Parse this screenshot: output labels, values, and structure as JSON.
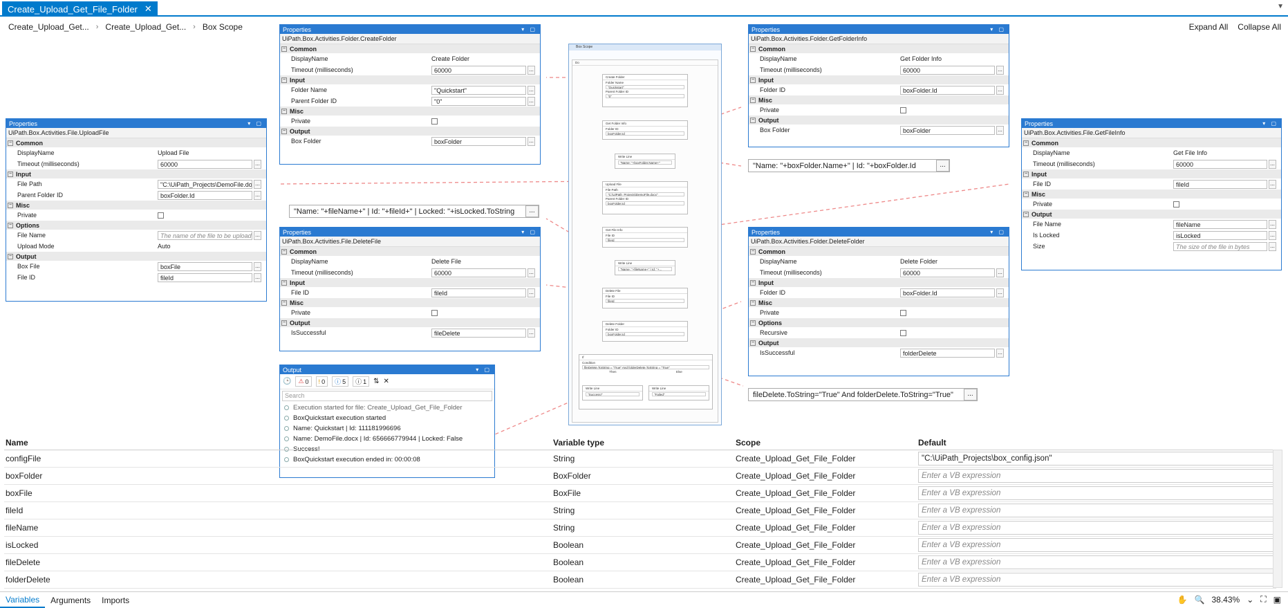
{
  "tab": {
    "title": "Create_Upload_Get_File_Folder",
    "close": "✕"
  },
  "breadcrumb": [
    "Create_Upload_Get...",
    "Create_Upload_Get...",
    "Box Scope"
  ],
  "expand_all": "Expand All",
  "collapse_all": "Collapse All",
  "panel_title": "Properties",
  "panels": {
    "create_folder": {
      "type": "UiPath.Box.Activities.Folder.CreateFolder",
      "cats": [
        [
          "Common",
          [
            [
              "DisplayName",
              "Create Folder",
              "text"
            ],
            [
              "Timeout (milliseconds)",
              "60000",
              "field"
            ]
          ]
        ],
        [
          "Input",
          [
            [
              "Folder Name",
              "\"Quickstart\"",
              "field"
            ],
            [
              "Parent Folder ID",
              "\"0\"",
              "field"
            ]
          ]
        ],
        [
          "Misc",
          [
            [
              "Private",
              "",
              "check"
            ]
          ]
        ],
        [
          "Output",
          [
            [
              "Box Folder",
              "boxFolder",
              "field"
            ]
          ]
        ]
      ]
    },
    "upload_file": {
      "type": "UiPath.Box.Activities.File.UploadFile",
      "cats": [
        [
          "Common",
          [
            [
              "DisplayName",
              "Upload File",
              "text"
            ],
            [
              "Timeout (milliseconds)",
              "60000",
              "field"
            ]
          ]
        ],
        [
          "Input",
          [
            [
              "File Path",
              "\"C:\\UiPath_Projects\\DemoFile.doc",
              "field"
            ],
            [
              "Parent Folder ID",
              "boxFolder.Id",
              "field"
            ]
          ]
        ],
        [
          "Misc",
          [
            [
              "Private",
              "",
              "check"
            ]
          ]
        ],
        [
          "Options",
          [
            [
              "File Name",
              "The name of the file to be uploade",
              "ph"
            ],
            [
              "Upload Mode",
              "Auto",
              "text"
            ]
          ]
        ],
        [
          "Output",
          [
            [
              "Box File",
              "boxFile",
              "field"
            ],
            [
              "File ID",
              "fileId",
              "field"
            ]
          ]
        ]
      ]
    },
    "delete_file": {
      "type": "UiPath.Box.Activities.File.DeleteFile",
      "cats": [
        [
          "Common",
          [
            [
              "DisplayName",
              "Delete File",
              "text"
            ],
            [
              "Timeout (milliseconds)",
              "60000",
              "field"
            ]
          ]
        ],
        [
          "Input",
          [
            [
              "File ID",
              "fileId",
              "field"
            ]
          ]
        ],
        [
          "Misc",
          [
            [
              "Private",
              "",
              "check"
            ]
          ]
        ],
        [
          "Output",
          [
            [
              "IsSuccessful",
              "fileDelete",
              "field"
            ]
          ]
        ]
      ]
    },
    "get_folder_info": {
      "type": "UiPath.Box.Activities.Folder.GetFolderInfo",
      "cats": [
        [
          "Common",
          [
            [
              "DisplayName",
              "Get Folder Info",
              "text"
            ],
            [
              "Timeout (milliseconds)",
              "60000",
              "field"
            ]
          ]
        ],
        [
          "Input",
          [
            [
              "Folder ID",
              "boxFolder.Id",
              "field"
            ]
          ]
        ],
        [
          "Misc",
          [
            [
              "Private",
              "",
              "check"
            ]
          ]
        ],
        [
          "Output",
          [
            [
              "Box Folder",
              "boxFolder",
              "field"
            ]
          ]
        ]
      ]
    },
    "get_file_info": {
      "type": "UiPath.Box.Activities.File.GetFileInfo",
      "cats": [
        [
          "Common",
          [
            [
              "DisplayName",
              "Get File Info",
              "text"
            ],
            [
              "Timeout (milliseconds)",
              "60000",
              "field"
            ]
          ]
        ],
        [
          "Input",
          [
            [
              "File ID",
              "fileId",
              "field"
            ]
          ]
        ],
        [
          "Misc",
          [
            [
              "Private",
              "",
              "check"
            ]
          ]
        ],
        [
          "Output",
          [
            [
              "File Name",
              "fileName",
              "field"
            ],
            [
              "Is Locked",
              "isLocked",
              "field"
            ],
            [
              "Size",
              "The size of the file in bytes",
              "ph"
            ]
          ]
        ]
      ]
    },
    "delete_folder": {
      "type": "UiPath.Box.Activities.Folder.DeleteFolder",
      "cats": [
        [
          "Common",
          [
            [
              "DisplayName",
              "Delete Folder",
              "text"
            ],
            [
              "Timeout (milliseconds)",
              "60000",
              "field"
            ]
          ]
        ],
        [
          "Input",
          [
            [
              "Folder ID",
              "boxFolder.Id",
              "field"
            ]
          ]
        ],
        [
          "Misc",
          [
            [
              "Private",
              "",
              "check"
            ]
          ]
        ],
        [
          "Options",
          [
            [
              "Recursive",
              "",
              "check"
            ]
          ]
        ],
        [
          "Output",
          [
            [
              "IsSuccessful",
              "folderDelete",
              "field"
            ]
          ]
        ]
      ]
    }
  },
  "expressions": {
    "folder_info": "\"Name: \"+boxFolder.Name+\" | Id: \"+boxFolder.Id",
    "file_info": "\"Name: \"+fileName+\" | Id: \"+fileId+\" | Locked: \"+isLocked.ToString",
    "condition": "fileDelete.ToString=\"True\" And folderDelete.ToString=\"True\"",
    "dots": "..."
  },
  "workflow": {
    "title": "Box Scope",
    "do": "Do",
    "acts": [
      "Create Folder",
      "Get Folder Info",
      "Write Line",
      "Upload File",
      "Get File Info",
      "Write Line",
      "Delete File",
      "Delete Folder",
      "If"
    ],
    "labels": {
      "folder_name": "Folder Name",
      "parent": "Parent Folder ID",
      "folder_id": "Folder ID",
      "file_path": "File Path",
      "file_id": "File ID",
      "text": "Text",
      "condition": "Condition",
      "then": "Then",
      "else": "Else"
    },
    "vals": {
      "quickstart": "\"Quickstart\"",
      "zero": "\"0\"",
      "folder_id": "boxFolder.Id",
      "wl1": "\"Name: \"+boxFolder.Name+\"",
      "path": "\"C:\\UiPath_Projects\\DemoFile.docx\"",
      "file_id": "fileId",
      "wl2": "\"Name: \"+fileName+\" | Id: \"+...",
      "cond": "fileDelete.ToString = \"True\" And folderDelete.ToString = \"True\"",
      "success": "\"Success!\"",
      "failed": "\"Failed\""
    }
  },
  "output": {
    "title": "Output",
    "counts": [
      "0",
      "0",
      "5",
      "1"
    ],
    "search": "Search",
    "lines": [
      "Execution started for file: Create_Upload_Get_File_Folder",
      "BoxQuickstart execution started",
      "Name: Quickstart | Id: 111181996696",
      "Name: DemoFile.docx | Id: 656666779944 | Locked: False",
      "Success!",
      "BoxQuickstart execution ended in: 00:00:08"
    ]
  },
  "vars": {
    "headers": [
      "Name",
      "Variable type",
      "Scope",
      "Default"
    ],
    "rows": [
      [
        "configFile",
        "String",
        "Create_Upload_Get_File_Folder",
        "\"C:\\UiPath_Projects\\box_config.json\""
      ],
      [
        "boxFolder",
        "BoxFolder",
        "Create_Upload_Get_File_Folder",
        "Enter a VB expression"
      ],
      [
        "boxFile",
        "BoxFile",
        "Create_Upload_Get_File_Folder",
        "Enter a VB expression"
      ],
      [
        "fileId",
        "String",
        "Create_Upload_Get_File_Folder",
        "Enter a VB expression"
      ],
      [
        "fileName",
        "String",
        "Create_Upload_Get_File_Folder",
        "Enter a VB expression"
      ],
      [
        "isLocked",
        "Boolean",
        "Create_Upload_Get_File_Folder",
        "Enter a VB expression"
      ],
      [
        "fileDelete",
        "Boolean",
        "Create_Upload_Get_File_Folder",
        "Enter a VB expression"
      ],
      [
        "folderDelete",
        "Boolean",
        "Create_Upload_Get_File_Folder",
        "Enter a VB expression"
      ]
    ]
  },
  "bottom": {
    "tabs": [
      "Variables",
      "Arguments",
      "Imports"
    ],
    "zoom": "38.43%"
  }
}
